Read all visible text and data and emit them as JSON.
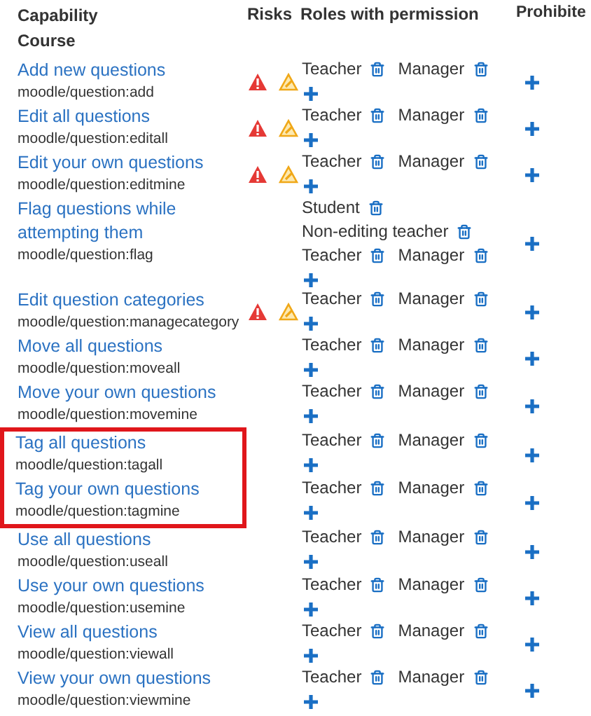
{
  "header": {
    "capability": "Capability",
    "risks": "Risks",
    "roles": "Roles with permission",
    "prohibited": "Prohibite"
  },
  "section": "Course",
  "rows": [
    {
      "label": "Add new questions",
      "code": "moodle/question:add",
      "risks": [
        {
          "kind": "warning"
        },
        {
          "kind": "edit"
        }
      ],
      "roles": [
        "Teacher",
        "Manager"
      ],
      "highlighted": false
    },
    {
      "label": "Edit all questions",
      "code": "moodle/question:editall",
      "risks": [
        {
          "kind": "warning"
        },
        {
          "kind": "edit"
        }
      ],
      "roles": [
        "Teacher",
        "Manager"
      ],
      "highlighted": false
    },
    {
      "label": "Edit your own questions",
      "code": "moodle/question:editmine",
      "risks": [
        {
          "kind": "warning"
        },
        {
          "kind": "edit"
        }
      ],
      "roles": [
        "Teacher",
        "Manager"
      ],
      "highlighted": false
    },
    {
      "label": "Flag questions while attempting them",
      "code": "moodle/question:flag",
      "risks": [],
      "roles": [
        "Student",
        "Non-editing teacher",
        "Teacher",
        "Manager"
      ],
      "highlighted": false
    },
    {
      "label": "Edit question categories",
      "code": "moodle/question:managecategory",
      "risks": [
        {
          "kind": "warning"
        },
        {
          "kind": "edit"
        }
      ],
      "roles": [
        "Teacher",
        "Manager"
      ],
      "highlighted": false
    },
    {
      "label": "Move all questions",
      "code": "moodle/question:moveall",
      "risks": [],
      "roles": [
        "Teacher",
        "Manager"
      ],
      "highlighted": false
    },
    {
      "label": "Move your own questions",
      "code": "moodle/question:movemine",
      "risks": [],
      "roles": [
        "Teacher",
        "Manager"
      ],
      "highlighted": false
    },
    {
      "label": "Tag all questions",
      "code": "moodle/question:tagall",
      "risks": [],
      "roles": [
        "Teacher",
        "Manager"
      ],
      "highlighted": true
    },
    {
      "label": "Tag your own questions",
      "code": "moodle/question:tagmine",
      "risks": [],
      "roles": [
        "Teacher",
        "Manager"
      ],
      "highlighted": true
    },
    {
      "label": "Use all questions",
      "code": "moodle/question:useall",
      "risks": [],
      "roles": [
        "Teacher",
        "Manager"
      ],
      "highlighted": false
    },
    {
      "label": "Use your own questions",
      "code": "moodle/question:usemine",
      "risks": [],
      "roles": [
        "Teacher",
        "Manager"
      ],
      "highlighted": false
    },
    {
      "label": "View all questions",
      "code": "moodle/question:viewall",
      "risks": [],
      "roles": [
        "Teacher",
        "Manager"
      ],
      "highlighted": false
    },
    {
      "label": "View your own questions",
      "code": "moodle/question:viewmine",
      "risks": [],
      "roles": [
        "Teacher",
        "Manager"
      ],
      "highlighted": false
    }
  ]
}
